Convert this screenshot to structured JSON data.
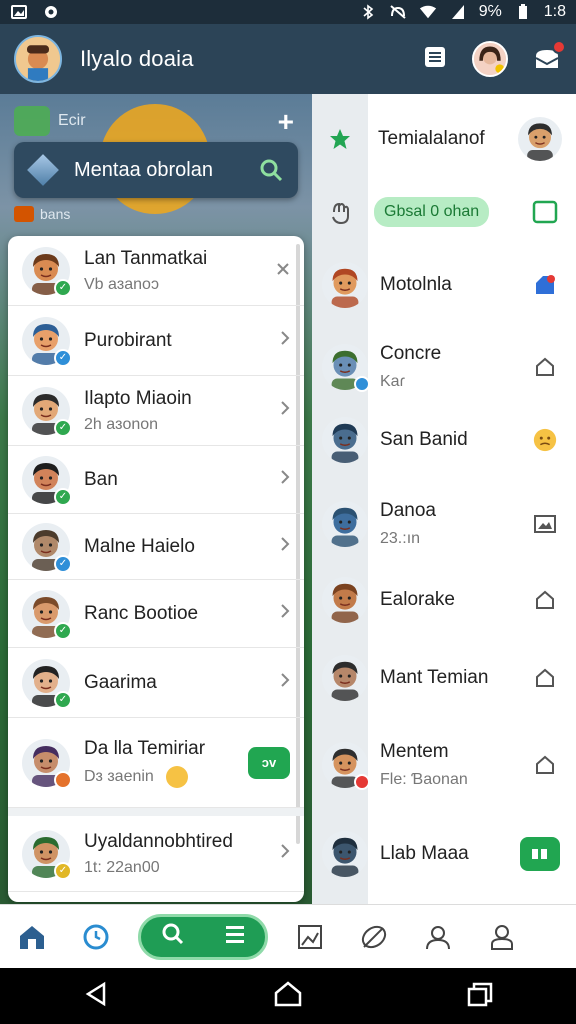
{
  "status_bar": {
    "battery_text": "9℅",
    "time": "1:8",
    "icons": [
      "image-icon",
      "location-icon",
      "bluetooth-icon",
      "mute-icon",
      "wifi-icon",
      "signal-icon",
      "battery-icon"
    ]
  },
  "app_bar": {
    "title": "Ilyalo doaia",
    "actions": [
      "list-icon",
      "profile-avatar",
      "notifications-icon"
    ]
  },
  "background": {
    "chip_label": "Ecir",
    "bans_label": "bans"
  },
  "banner": {
    "label": "Mentaa obrolan"
  },
  "left_list": [
    {
      "name": "Lan Tanmatkai",
      "sub": "Vb aɜanoɔ",
      "badge": "check",
      "badge_color": "#2fa84f",
      "trail": "close-icon",
      "face": "#d98b52",
      "hair": "#6b3a1b"
    },
    {
      "name": "Purobirant",
      "sub": "",
      "badge": "check",
      "badge_color": "#2f8fd8",
      "trail": "chevron-right-icon",
      "face": "#e8a06a",
      "hair": "#2d5f96"
    },
    {
      "name": "Ilapto Miaoin",
      "sub": "2h aɜonon",
      "badge": "check",
      "badge_color": "#2fa84f",
      "trail": "chevron-right-icon",
      "face": "#e2a877",
      "hair": "#2b2b2b"
    },
    {
      "name": "Ban",
      "sub": "",
      "badge": "check",
      "badge_color": "#2fa84f",
      "trail": "chevron-right-icon",
      "face": "#d1835a",
      "hair": "#1d1d1d"
    },
    {
      "name": "Malne Haielo",
      "sub": "",
      "badge": "check",
      "badge_color": "#2f8fd8",
      "trail": "chevron-right-icon",
      "face": "#b0896a",
      "hair": "#4b3b2c"
    },
    {
      "name": "Ranc Bootioe",
      "sub": "",
      "badge": "check",
      "badge_color": "#2fa84f",
      "trail": "chevron-right-icon",
      "face": "#d99a6c",
      "hair": "#7b4b2a"
    },
    {
      "name": "Gaarima",
      "sub": "",
      "badge": "check",
      "badge_color": "#2fa84f",
      "trail": "chevron-right-icon",
      "face": "#e2b08b",
      "hair": "#222"
    },
    {
      "name": "Da lla Temiriar",
      "sub": "Dɜ ɜaenin",
      "badge": "dot",
      "badge_color": "#e4722c",
      "trail": "green-pill",
      "pill": "ɔv",
      "face": "#c68d6b",
      "hair": "#452d5f"
    },
    {
      "name": "Uyaldannobhtired",
      "sub": "1t: 22an00",
      "badge": "check",
      "badge_color": "#e1b726",
      "trail": "chevron-right-icon",
      "face": "#cf9364",
      "hair": "#2a6b2f"
    }
  ],
  "right_list": [
    {
      "name": "Temialalanof",
      "sub": "",
      "lead": "star-icon",
      "trail_type": "avatar",
      "face": "#d9a06b",
      "hair": "#2d2d2d"
    },
    {
      "name": "",
      "sub": "",
      "lead": "wave-icon",
      "pill": "Gbsal 0 ohan",
      "trail_type": "square-outline"
    },
    {
      "name": "Motolnla",
      "sub": "",
      "avatar": true,
      "trail_type": "bookmark",
      "face": "#e09a5e",
      "hair": "#b04723"
    },
    {
      "name": "Concre",
      "sub": "Kaɾ",
      "avatar": true,
      "badge_color": "#2f8fd8",
      "trail_type": "outline",
      "face": "#6a8fb6",
      "hair": "#3c6e2e"
    },
    {
      "name": "San Banid",
      "sub": "",
      "avatar": true,
      "trail_type": "emoji",
      "face": "#4a6d8f",
      "hair": "#1f3a55"
    },
    {
      "name": "Danoa",
      "sub": "23.:ın",
      "avatar": true,
      "trail_type": "image-outline",
      "face": "#3e6e9e",
      "hair": "#2b5172"
    },
    {
      "name": "Ealorake",
      "sub": "",
      "avatar": true,
      "trail_type": "outline",
      "face": "#c27b4a",
      "hair": "#7a4220"
    },
    {
      "name": "Mant Temian",
      "sub": "",
      "avatar": true,
      "trail_type": "outline",
      "face": "#b6876a",
      "hair": "#2d2d2d"
    },
    {
      "name": "Mentem",
      "sub": "Fle: Ɓaonan",
      "avatar": true,
      "badge_color": "#e53935",
      "trail_type": "outline",
      "face": "#d5935e",
      "hair": "#2f2f2f"
    },
    {
      "name": "Llab Maaa",
      "sub": "",
      "avatar": true,
      "trail_type": "green-chip",
      "face": "#3c566e",
      "hair": "#1f2f3e"
    }
  ],
  "bottom_nav": {
    "items": [
      "home-icon",
      "clock-icon",
      "search-icon",
      "menu-icon",
      "image-edit-icon",
      "leaf-icon",
      "person-icon",
      "account-icon"
    ]
  },
  "colors": {
    "app_bar": "#2c4457",
    "accent_green": "#1f9d55",
    "banner": "#2f4a60"
  }
}
